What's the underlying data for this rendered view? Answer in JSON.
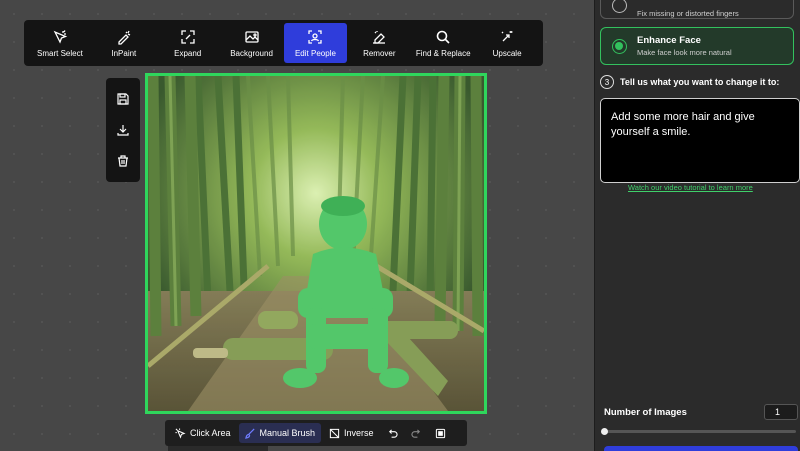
{
  "toolbar": {
    "items": [
      {
        "label": "Smart Select",
        "icon": "smart-select-icon"
      },
      {
        "label": "InPaint",
        "icon": "inpaint-icon"
      },
      {
        "label": "Expand",
        "icon": "expand-icon"
      },
      {
        "label": "Background",
        "icon": "background-icon"
      },
      {
        "label": "Edit People",
        "icon": "edit-people-icon",
        "active": true
      },
      {
        "label": "Remover",
        "icon": "remover-icon"
      },
      {
        "label": "Find & Replace",
        "icon": "search-icon"
      },
      {
        "label": "Upscale",
        "icon": "upscale-icon"
      }
    ]
  },
  "side_tools": [
    "save-icon",
    "download-icon",
    "trash-icon"
  ],
  "bottom_bar": {
    "click_area": "Click Area",
    "manual_brush": "Manual Brush",
    "inverse": "Inverse"
  },
  "panel": {
    "option_top": {
      "desc": "Fix missing or distorted fingers"
    },
    "option_selected": {
      "title": "Enhance Face",
      "desc": "Make face look more natural"
    },
    "step3": {
      "num": "3",
      "text": "Tell us what you want to change it to:"
    },
    "prompt": "Add some more hair and give yourself a smile.",
    "tutorial_link": "Watch our video tutorial to learn more",
    "num_images_label": "Number of Images",
    "num_images_value": "1"
  },
  "colors": {
    "accent_blue": "#2f3ddb",
    "accent_green": "#33c15e",
    "mask_green": "#2fd65c"
  }
}
